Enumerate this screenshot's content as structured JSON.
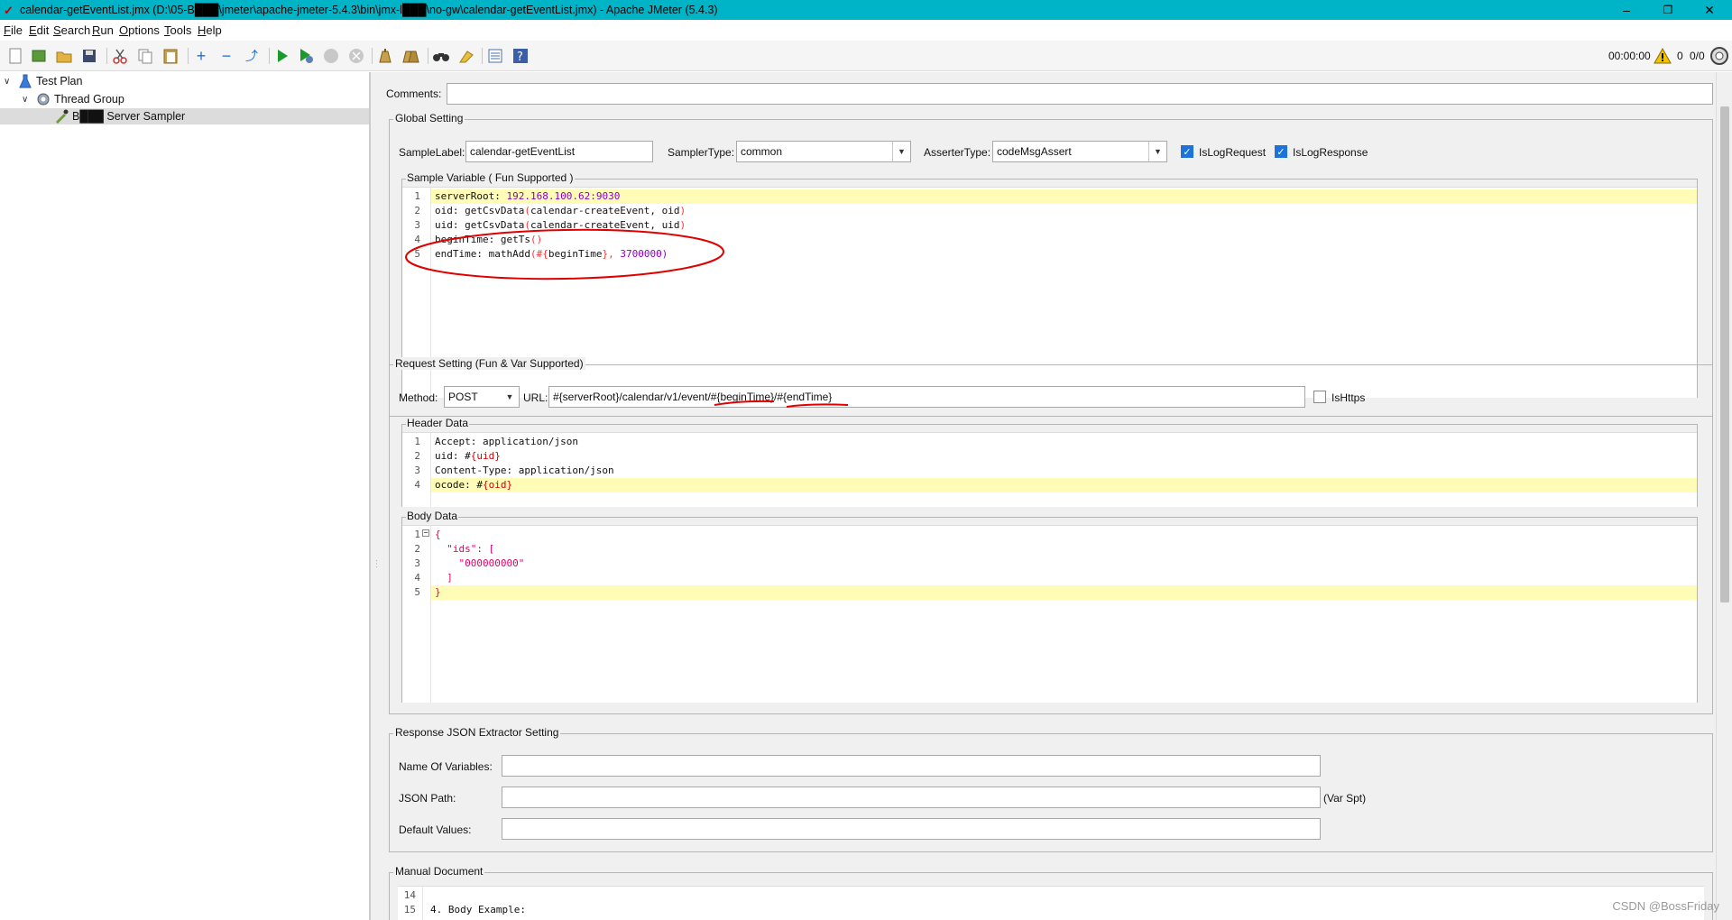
{
  "window": {
    "title": "calendar-getEventList.jmx (D:\\05-B███\\jmeter\\apache-jmeter-5.4.3\\bin\\jmx-l███\\no-gw\\calendar-getEventList.jmx) - Apache JMeter (5.4.3)",
    "minimize": "–",
    "maximize": "❐",
    "close": "✕"
  },
  "menu": [
    {
      "label": "File"
    },
    {
      "label": "Edit"
    },
    {
      "label": "Search"
    },
    {
      "label": "Run"
    },
    {
      "label": "Options"
    },
    {
      "label": "Tools"
    },
    {
      "label": "Help"
    }
  ],
  "status": {
    "timer": "00:00:00",
    "warnings": "0",
    "threads": "0/0"
  },
  "tree": {
    "test_plan": "Test Plan",
    "thread_group": "Thread Group",
    "sampler": "B███ Server Sampler"
  },
  "comments_label": "Comments:",
  "comments_value": "",
  "global_setting": {
    "legend": "Global Setting",
    "sample_label_label": "SampleLabel:",
    "sample_label_value": "calendar-getEventList",
    "sampler_type_label": "SamplerType:",
    "sampler_type_value": "common",
    "asserter_type_label": "AsserterType:",
    "asserter_type_value": "codeMsgAssert",
    "is_log_request": "IsLogRequest",
    "is_log_response": "IsLogResponse",
    "sample_variable_legend": "Sample Variable ( Fun Supported )"
  },
  "sample_variable_lines": [
    {
      "n": "1",
      "a": "serverRoot: ",
      "b": "192.168.100.62:9030",
      "c": "",
      "d": "",
      "e": ""
    },
    {
      "n": "2",
      "a": "oid: getCsvData",
      "b": "(",
      "c": "calendar-createEvent, oid",
      "d": ")",
      "e": ""
    },
    {
      "n": "3",
      "a": "uid: getCsvData",
      "b": "(",
      "c": "calendar-createEvent, uid",
      "d": ")",
      "e": ""
    },
    {
      "n": "4",
      "a": "beginTime: getTs",
      "b": "()",
      "c": "",
      "d": "",
      "e": ""
    },
    {
      "n": "5",
      "a": "endTime: mathAdd",
      "b": "(#{",
      "c": "beginTime",
      "d": "}, ",
      "e": "3700000)"
    }
  ],
  "request_setting": {
    "legend": "Request Setting (Fun & Var Supported)",
    "method_label": "Method:",
    "method_value": "POST",
    "url_label": "URL:",
    "url_value": "#{serverRoot}/calendar/v1/event/#{beginTime}/#{endTime}",
    "is_https": "IsHttps",
    "header_legend": "Header Data",
    "body_legend": "Body Data"
  },
  "header_lines": [
    {
      "n": "1",
      "a": "Accept: application/json",
      "b": ""
    },
    {
      "n": "2",
      "a": "uid: #",
      "b": "{uid}"
    },
    {
      "n": "3",
      "a": "Content-Type: application/json",
      "b": ""
    },
    {
      "n": "4",
      "a": "ocode: #",
      "b": "{oid}"
    }
  ],
  "body_lines": [
    {
      "n": "1",
      "t": "{"
    },
    {
      "n": "2",
      "t": "  \"ids\": ["
    },
    {
      "n": "3",
      "t": "    \"000000000\""
    },
    {
      "n": "4",
      "t": "  ]"
    },
    {
      "n": "5",
      "t": "}"
    }
  ],
  "json_extractor": {
    "legend": "Response JSON Extractor Setting",
    "name_label": "Name Of Variables:",
    "name_value": "",
    "path_label": "JSON Path:",
    "path_value": "",
    "path_hint": "(Var Spt)",
    "default_label": "Default Values:",
    "default_value": ""
  },
  "manual": {
    "legend": "Manual Document",
    "lines": [
      {
        "n": "14",
        "t": ""
      },
      {
        "n": "15",
        "t": "4. Body Example:"
      }
    ]
  },
  "watermark": "CSDN @BossFriday",
  "colors": {
    "titlebar": "#00b4c8",
    "highlight_line": "#fffcb8",
    "annotation": "#e00000",
    "checkbox": "#1e73d8"
  }
}
